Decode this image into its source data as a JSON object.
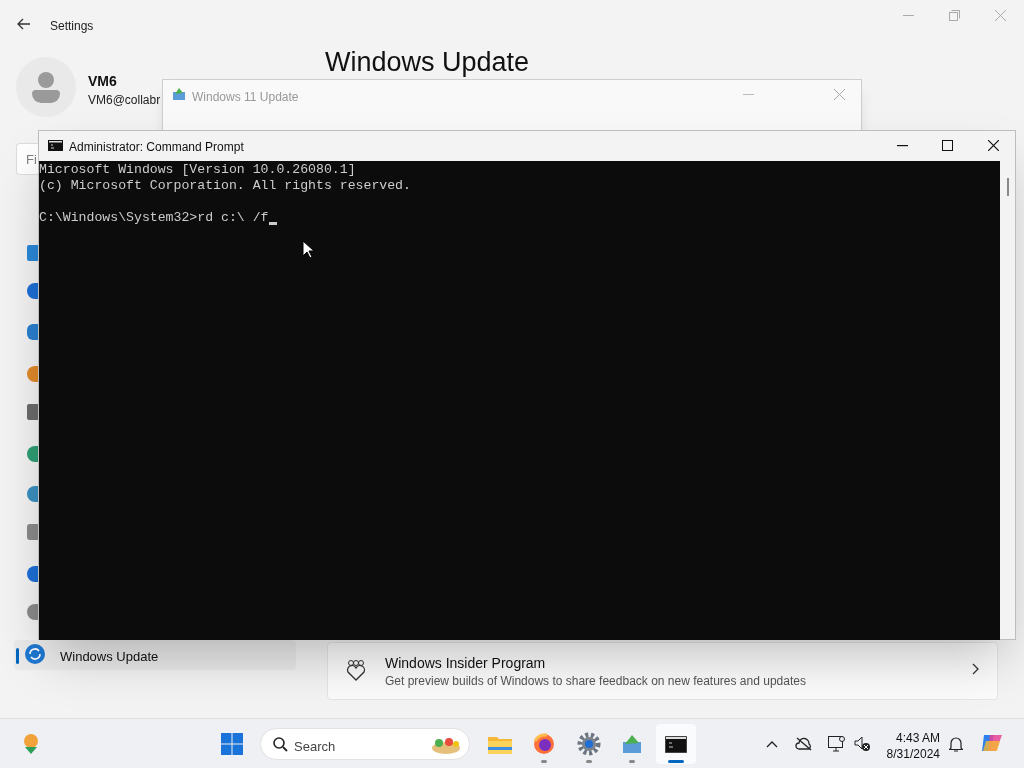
{
  "settings": {
    "title": "Settings",
    "user_name": "VM6",
    "user_email": "VM6@collabr",
    "search_placeholder": "Fi",
    "page_heading": "Windows Update",
    "sidebar_items": [
      {
        "label": "Windows Update",
        "selected": true
      }
    ],
    "insider_card": {
      "title": "Windows Insider Program",
      "description": "Get preview builds of Windows to share feedback on new features and updates"
    }
  },
  "update_window": {
    "title": "Windows 11 Update"
  },
  "cmd_window": {
    "title": "Administrator: Command Prompt",
    "blocks": [
      [
        "Microsoft Windows [Version 10.0.26080.1]",
        "(c) Microsoft Corporation. All rights reserved."
      ],
      [
        "C:\\Windows\\System32>rd c:\\ /f"
      ]
    ]
  },
  "taskbar": {
    "search_label": "Search",
    "apps": [
      {
        "kind": "explorer",
        "running": false,
        "selected": false
      },
      {
        "kind": "firefox",
        "running": true,
        "selected": false
      },
      {
        "kind": "settings",
        "running": true,
        "selected": false
      },
      {
        "kind": "updater",
        "running": true,
        "selected": false
      },
      {
        "kind": "terminal",
        "running": true,
        "selected": true
      }
    ],
    "time": "4:43 AM",
    "date": "8/31/2024"
  }
}
